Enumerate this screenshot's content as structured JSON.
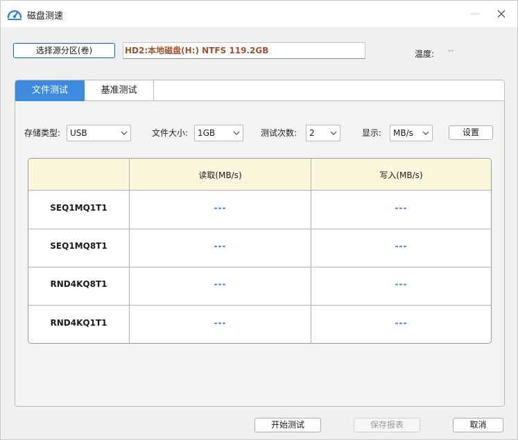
{
  "window": {
    "title": "磁盘测速",
    "minimize_glyph": "—"
  },
  "source": {
    "select_button_label": "选择源分区(卷)",
    "selected_partition": "HD2:本地磁盘(H:) NTFS 119.2GB"
  },
  "temperature": {
    "label": "温度:",
    "value": "--"
  },
  "tabs": [
    {
      "label": "文件测试",
      "active": true
    },
    {
      "label": "基准测试",
      "active": false
    }
  ],
  "options": {
    "storage_type": {
      "label": "存储类型:",
      "value": "USB"
    },
    "file_size": {
      "label": "文件大小:",
      "value": "1GB"
    },
    "test_count": {
      "label": "测试次数:",
      "value": "2"
    },
    "display_unit": {
      "label": "显示:",
      "value": "MB/s"
    },
    "settings_label": "设置"
  },
  "results": {
    "columns": [
      "",
      "读取(MB/s)",
      "写入(MB/s)"
    ],
    "rows": [
      {
        "name": "SEQ1MQ1T1",
        "read": "---",
        "write": "---"
      },
      {
        "name": "SEQ1MQ8T1",
        "read": "---",
        "write": "---"
      },
      {
        "name": "RND4KQ8T1",
        "read": "---",
        "write": "---"
      },
      {
        "name": "RND4KQ1T1",
        "read": "---",
        "write": "---"
      }
    ]
  },
  "footer": {
    "start_label": "开始测试",
    "save_report_label": "保存报表",
    "cancel_label": "取消"
  },
  "colors": {
    "accent": "#3d8be0",
    "header_bg": "#fbf7dc",
    "value_blue": "#3a6fd8",
    "partition_text": "#a0522d",
    "temp_green": "#34a853"
  },
  "icons": {
    "app": "speedometer-icon",
    "close": "close-icon",
    "dropdown": "chevron-down-icon"
  }
}
